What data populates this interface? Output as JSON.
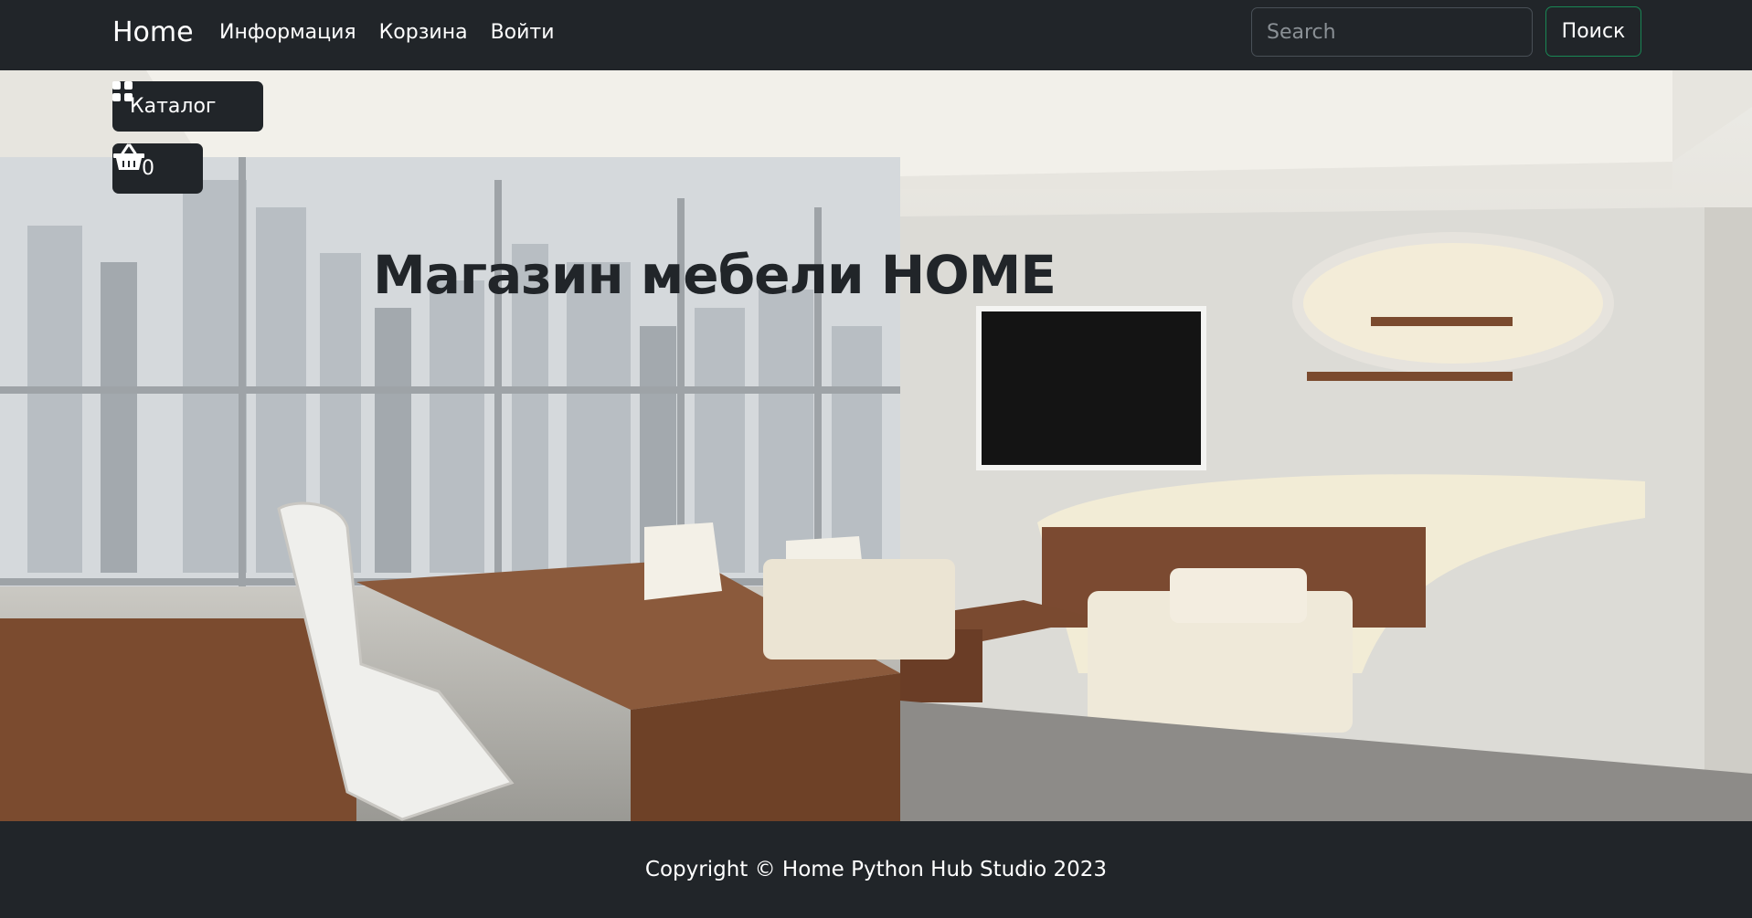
{
  "navbar": {
    "brand": "Home",
    "links": [
      "Информация",
      "Корзина",
      "Войти"
    ],
    "search_placeholder": "Search",
    "search_button": "Поиск"
  },
  "hero": {
    "catalog_label": "Каталог",
    "cart_count": "0",
    "title": "Магазин мебели HOME"
  },
  "footer": {
    "copyright": "Copyright © Home Python Hub Studio 2023"
  },
  "icons": {
    "catalog": "grid-icon",
    "cart": "basket-icon"
  },
  "colors": {
    "dark": "#212529",
    "search_border_accent": "#198754"
  }
}
